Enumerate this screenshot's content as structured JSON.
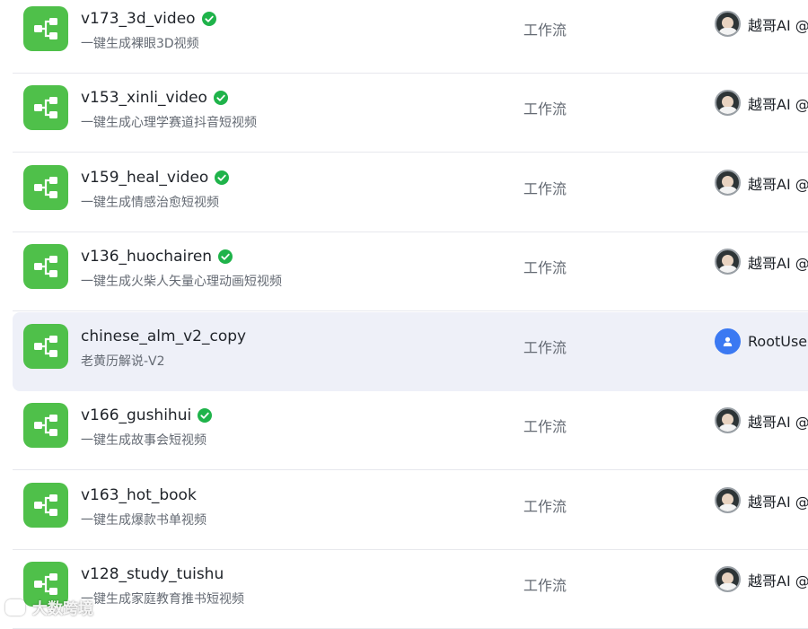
{
  "rows": [
    {
      "title": "v173_3d_video",
      "desc": "一键生成裸眼3D视频",
      "type": "工作流",
      "owner": "越哥AI @",
      "verified": true,
      "avatar": "photo"
    },
    {
      "title": "v153_xinli_video",
      "desc": "一键生成心理学赛道抖音短视频",
      "type": "工作流",
      "owner": "越哥AI @",
      "verified": true,
      "avatar": "photo"
    },
    {
      "title": "v159_heal_video",
      "desc": "一键生成情感治愈短视频",
      "type": "工作流",
      "owner": "越哥AI @",
      "verified": true,
      "avatar": "photo"
    },
    {
      "title": "v136_huochairen",
      "desc": "一键生成火柴人矢量心理动画短视频",
      "type": "工作流",
      "owner": "越哥AI @",
      "verified": true,
      "avatar": "photo"
    },
    {
      "title": "chinese_alm_v2_copy",
      "desc": "老黄历解说-V2",
      "type": "工作流",
      "owner": "RootUse",
      "verified": false,
      "avatar": "user"
    },
    {
      "title": "v166_gushihui",
      "desc": "一键生成故事会短视频",
      "type": "工作流",
      "owner": "越哥AI @",
      "verified": true,
      "avatar": "photo"
    },
    {
      "title": "v163_hot_book",
      "desc": "一键生成爆款书单视频",
      "type": "工作流",
      "owner": "越哥AI @",
      "verified": false,
      "avatar": "photo"
    },
    {
      "title": "v128_study_tuishu",
      "desc": "一键生成家庭教育推书短视频",
      "type": "工作流",
      "owner": "越哥AI @",
      "verified": false,
      "avatar": "photo"
    }
  ],
  "highlighted_row": 4,
  "watermark": "大数跨境",
  "colors": {
    "app_icon": "#4fc04a",
    "verified": "#1fb34a",
    "user_avatar": "#3b79f2",
    "hover": "#eef0f8"
  },
  "icons": {
    "app": "workflow-icon",
    "verified": "check-circle-icon",
    "user": "user-icon"
  }
}
